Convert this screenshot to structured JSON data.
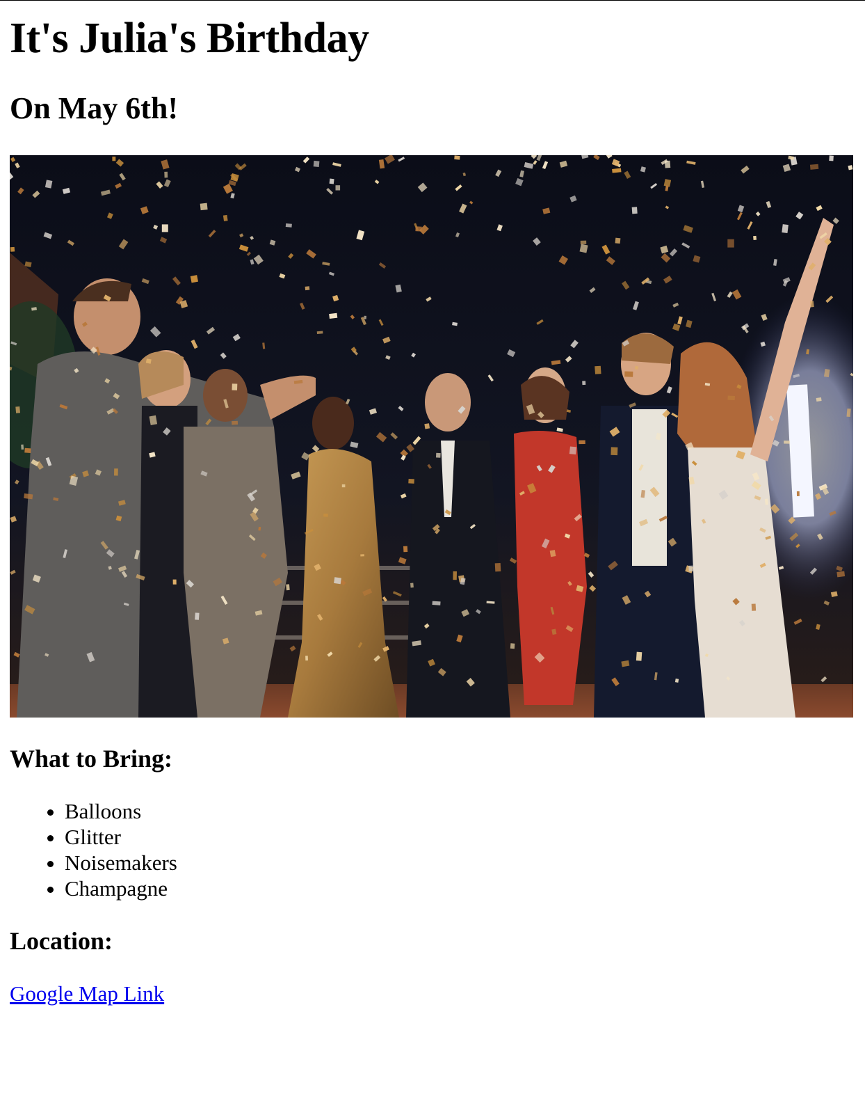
{
  "page": {
    "title": "It's Julia's Birthday",
    "subtitle": "On May 6th!"
  },
  "photo": {
    "alt": "Friends celebrating under falling gold confetti"
  },
  "bring": {
    "heading": "What to Bring:",
    "items": [
      "Balloons",
      "Glitter",
      "Noisemakers",
      "Champagne"
    ]
  },
  "location": {
    "heading": "Location:",
    "link_label": "Google Map Link"
  },
  "colors": {
    "link": "#0000ee",
    "text": "#000000",
    "background": "#ffffff"
  }
}
